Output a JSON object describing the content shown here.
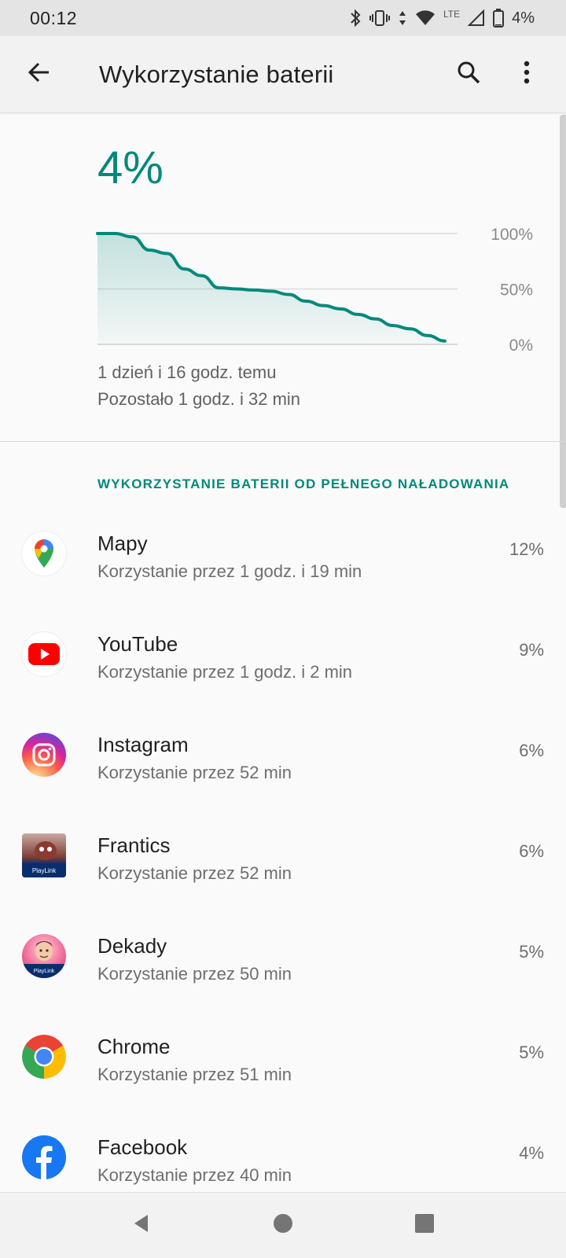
{
  "status_bar": {
    "time": "00:12",
    "network_label": "LTE",
    "battery_text": "4%"
  },
  "app_bar": {
    "title": "Wykorzystanie baterii"
  },
  "battery": {
    "percent": "4%",
    "since": "1 dzień i 16 godz. temu",
    "remaining": "Pozostało 1 godz. i 32 min"
  },
  "chart_data": {
    "type": "area",
    "title": "",
    "xlabel": "",
    "ylabel": "",
    "ylim": [
      0,
      100
    ],
    "ytick_labels": [
      "100%",
      "50%",
      "0%"
    ],
    "x": [
      0,
      1,
      2,
      3,
      4,
      5,
      6,
      7,
      8,
      9,
      10,
      11,
      12,
      13,
      14,
      15,
      16,
      17,
      18,
      19,
      20
    ],
    "values": [
      100,
      100,
      97,
      85,
      82,
      68,
      62,
      51,
      50,
      49,
      48,
      45,
      39,
      35,
      32,
      27,
      23,
      17,
      14,
      8,
      3
    ],
    "color": "#00897b",
    "fill": "#e0f2f1",
    "grid": true
  },
  "section": {
    "header": "WYKORZYSTANIE BATERII OD PEŁNEGO NAŁADOWANIA"
  },
  "apps": [
    {
      "name": "Mapy",
      "usage": "Korzystanie przez 1 godz. i 19 min",
      "percent": "12%",
      "icon": "google-maps-icon"
    },
    {
      "name": "YouTube",
      "usage": "Korzystanie przez 1 godz. i 2 min",
      "percent": "9%",
      "icon": "youtube-icon"
    },
    {
      "name": "Instagram",
      "usage": "Korzystanie przez 52 min",
      "percent": "6%",
      "icon": "instagram-icon"
    },
    {
      "name": "Frantics",
      "usage": "Korzystanie przez 52 min",
      "percent": "6%",
      "icon": "frantics-icon"
    },
    {
      "name": "Dekady",
      "usage": "Korzystanie przez 50 min",
      "percent": "5%",
      "icon": "dekady-icon"
    },
    {
      "name": "Chrome",
      "usage": "Korzystanie przez 51 min",
      "percent": "5%",
      "icon": "chrome-icon"
    },
    {
      "name": "Facebook",
      "usage": "Korzystanie przez 40 min",
      "percent": "4%",
      "icon": "facebook-icon"
    }
  ],
  "icon_badges": {
    "playlink": "PlayLink"
  },
  "colors": {
    "accent": "#00897b",
    "youtube": "#ff0000",
    "facebook": "#1877f2"
  }
}
